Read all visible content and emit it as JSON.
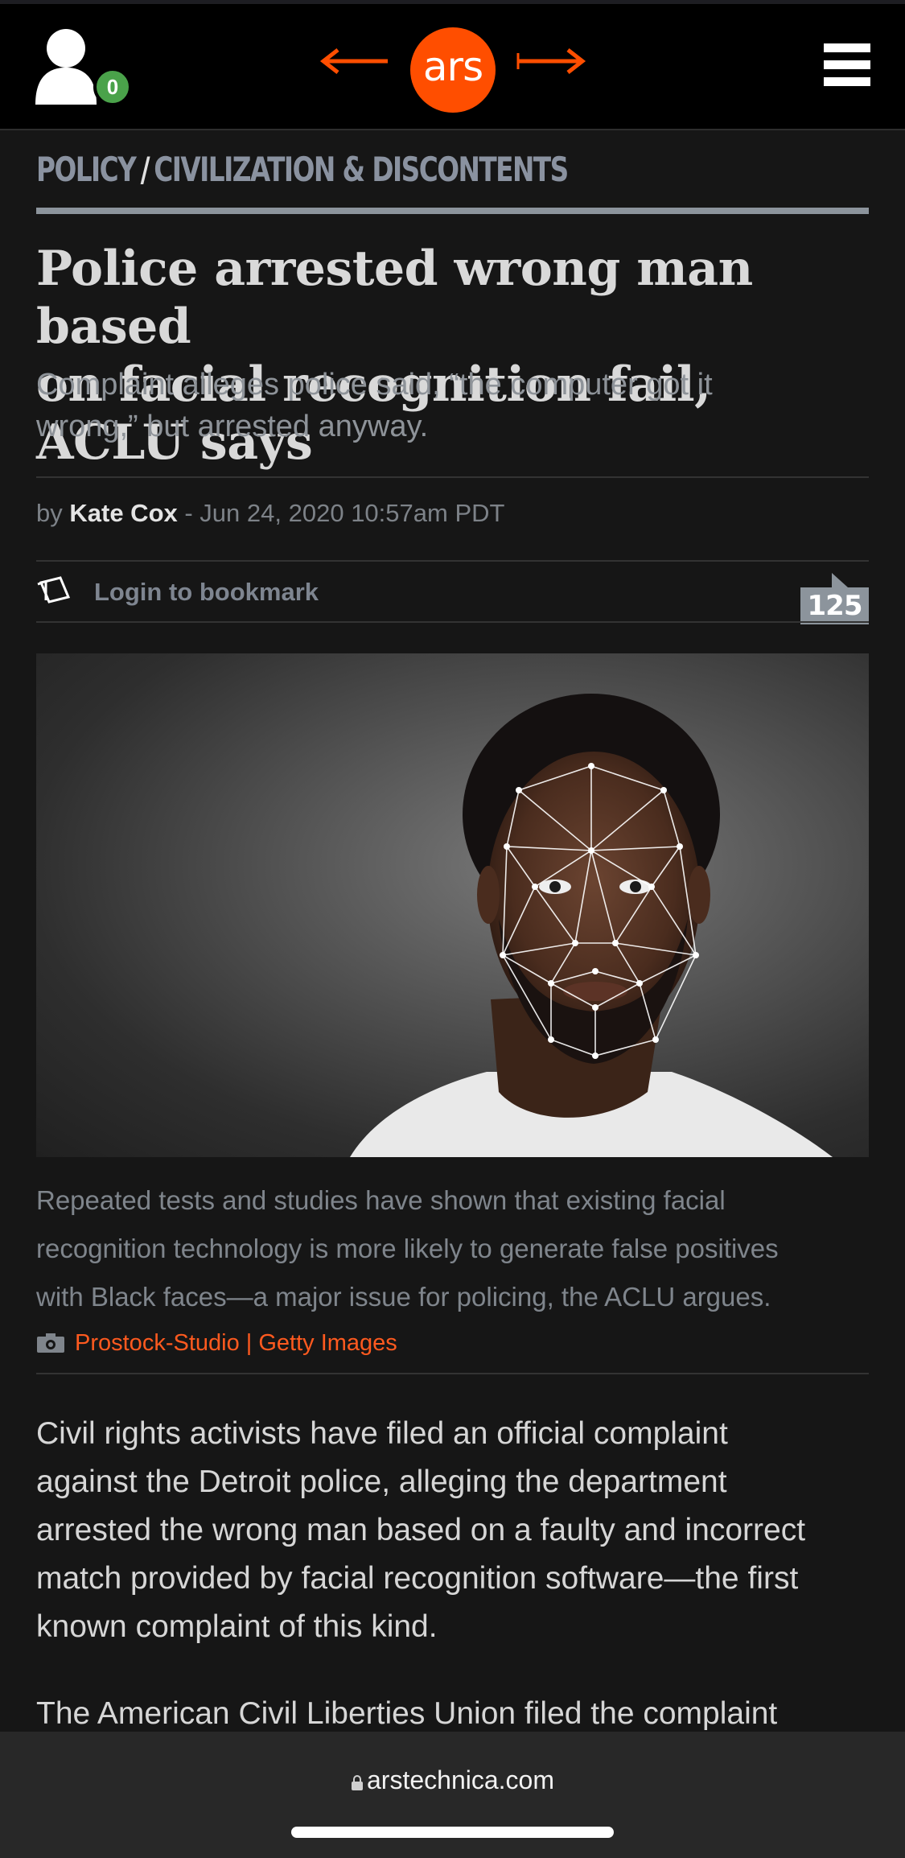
{
  "header": {
    "notification_count": "0",
    "logo_text": "ars",
    "accent_color": "#ff4e00"
  },
  "breadcrumb": {
    "section": "POLICY",
    "separator": "/",
    "subsection": "CIVILIZATION & DISCONTENTS"
  },
  "article": {
    "title_line1": "Police arrested wrong man based",
    "title_line2": "on facial recognition fail, ACLU says",
    "dek_line1": "Complaint alleges police said, “the computer got it",
    "dek_line2": "wrong,” but arrested anyway.",
    "byline_prefix": "by",
    "author": "Kate Cox",
    "date": "- Jun 24, 2020 10:57am PDT",
    "bookmark_label": "Login to bookmark",
    "comment_count": "125",
    "image_description_icon": "face-mesh-photo",
    "caption_line1": "Repeated tests and studies have shown that existing facial",
    "caption_line2": "recognition technology is more likely to generate false positives",
    "caption_line3": "with Black faces—a major issue for policing, the ACLU argues.",
    "credit": "Prostock-Studio | Getty Images",
    "paragraph1_lines": [
      "Civil rights activists have filed an official complaint",
      "against the Detroit police, alleging the department",
      "arrested the wrong man based on a faulty and incorrect",
      "match provided by facial recognition software—the first",
      "known complaint of this kind."
    ],
    "paragraph2_partial": "The American Civil Liberties Union filed the complaint"
  },
  "browser": {
    "url": "arstechnica.com"
  }
}
